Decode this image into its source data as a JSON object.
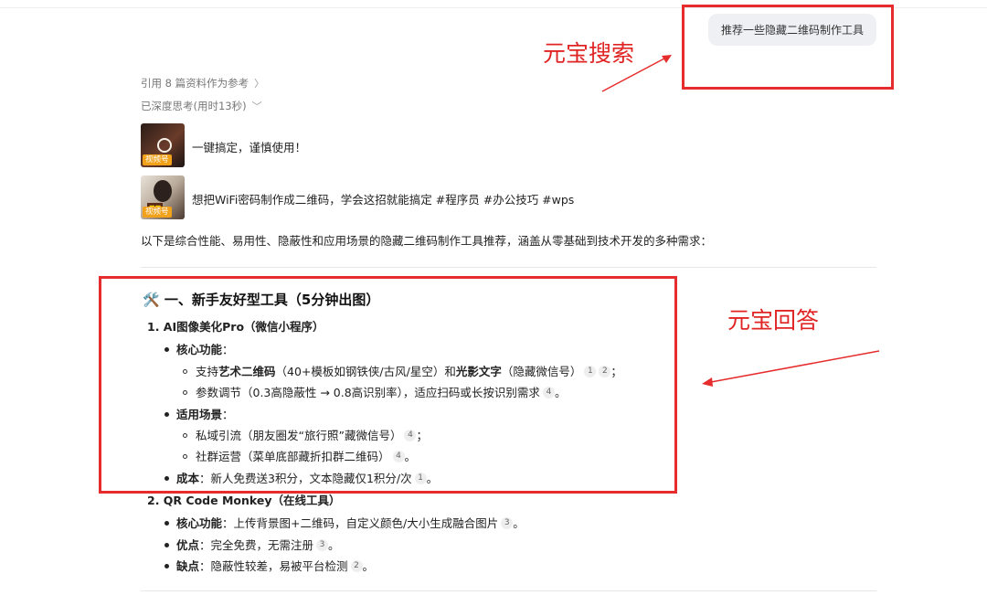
{
  "query": {
    "text": "推荐一些隐藏二维码制作工具"
  },
  "annotations": {
    "search_label": "元宝搜索",
    "answer_label": "元宝回答"
  },
  "meta": {
    "references": "引用 8 篇资料作为参考",
    "thinking": "已深度思考(用时13秒)"
  },
  "videos": [
    {
      "title": "一键搞定，谨慎使用！",
      "badge": "视频号"
    },
    {
      "title": "想把WiFi密码制作成二维码，学会这招就能搞定 #程序员 #办公技巧 #wps",
      "badge": "视频号"
    }
  ],
  "intro": "以下是综合性能、易用性、隐蔽性和应用场景的隐藏二维码制作工具推荐，涵盖从零基础到技术开发的多种需求：",
  "section1": {
    "icon": "🛠️",
    "title": "一、新手友好型工具（5分钟出图）",
    "tool1": {
      "name": "1. AI图像美化Pro（微信小程序）",
      "core_label": "核心功能",
      "core_items": [
        {
          "pre": "支持",
          "b1": "艺术二维码",
          "mid": "（40+模板如钢铁侠/古风/星空）和",
          "b2": "光影文字",
          "post": "（隐藏微信号）",
          "cites": [
            "1",
            "2"
          ],
          "end": "；"
        },
        {
          "text": "参数调节（0.3高隐蔽性 → 0.8高识别率），适应扫码或长按识别需求",
          "cites": [
            "4"
          ],
          "end": "。"
        }
      ],
      "scene_label": "适用场景",
      "scene_items": [
        {
          "text": "私域引流（朋友圈发“旅行照”藏微信号）",
          "cites": [
            "4"
          ],
          "end": "；"
        },
        {
          "text": "社群运营（菜单底部藏折扣群二维码）",
          "cites": [
            "4"
          ],
          "end": "。"
        }
      ],
      "cost_label": "成本",
      "cost_text": "：新人免费送3积分，文本隐藏仅1积分/次",
      "cost_cite": "1",
      "cost_end": "。"
    },
    "tool2": {
      "name": "2. QR Code Monkey（在线工具）",
      "core_label": "核心功能",
      "core_text": "：上传背景图+二维码，自定义颜色/大小生成融合图片",
      "core_cite": "3",
      "core_end": "。",
      "pro_label": "优点",
      "pro_text": "：完全免费，无需注册",
      "pro_cite": "3",
      "pro_end": "。",
      "con_label": "缺点",
      "con_text": "：隐蔽性较差，易被平台检测",
      "con_cite": "2",
      "con_end": "。"
    }
  },
  "colors": {
    "annotation_red": "#e62c2c",
    "bubble_bg": "#eef0f3"
  }
}
